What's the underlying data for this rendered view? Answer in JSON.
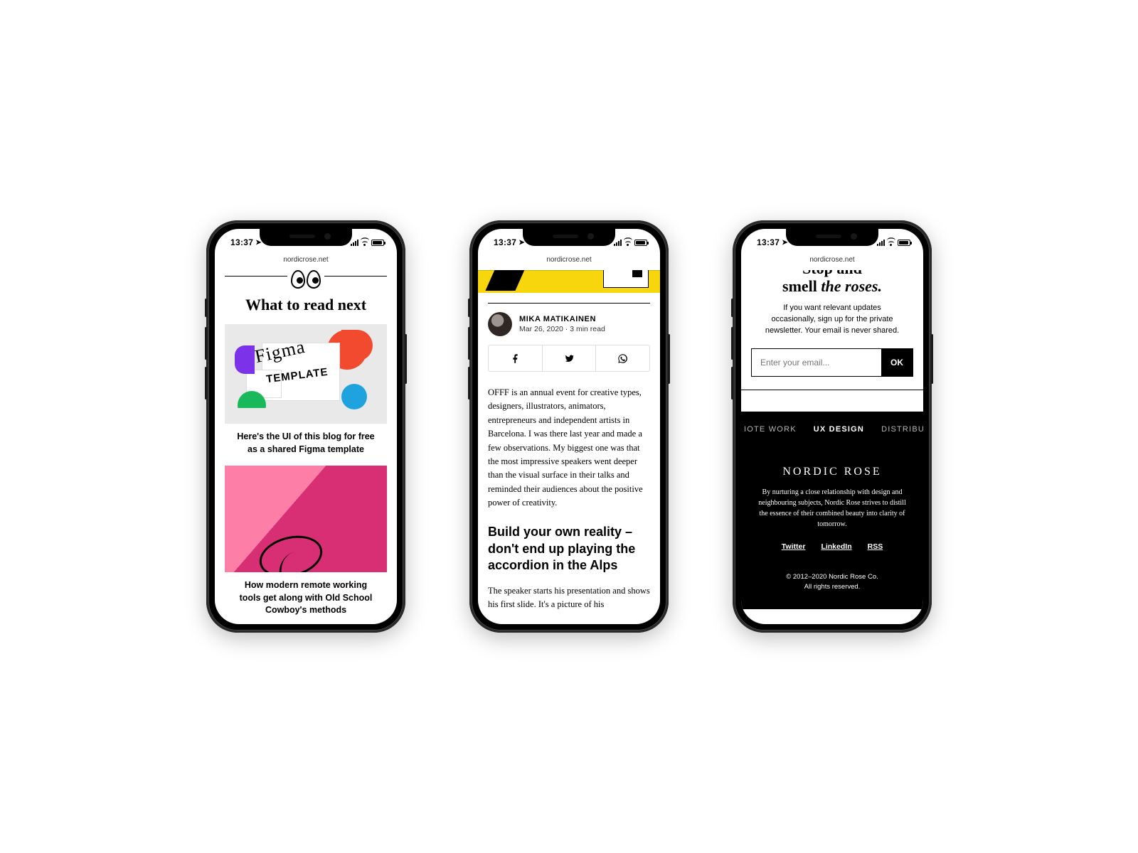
{
  "status": {
    "time": "13:37",
    "domain": "nordicrose.net"
  },
  "phone1": {
    "heading": "What to read next",
    "figma_word": "Figma",
    "template_word": "TEMPLATE",
    "card1_title": "Here's the UI of this blog for free as a shared Figma template",
    "card2_title": "How modern remote working tools get along with Old School Cowboy's methods"
  },
  "phone2": {
    "author_name": "MIKA MATIKAINEN",
    "author_meta": "Mar 26, 2020 · 3 min read",
    "paragraph1": "OFFF is an annual event for creative types, designers, illustrators, animators, entrepreneurs and independent artists in Barcelona. I was there last year and made a few observations. My biggest one was that the most impressive speakers went deeper than the visual surface in their talks and reminded their audiences about the positive power of creativity.",
    "article_heading": "Build your own reality – don't end up playing the accordion in the Alps",
    "paragraph2": "The speaker starts his presentation and shows his first slide. It's a picture of his"
  },
  "phone3": {
    "roses_line1_cut": "Stop and",
    "roses_smell": "smell",
    "roses_the_roses": " the roses.",
    "newsletter_desc": "If you want relevant updates occasionally, sign up for the private newsletter. Your email is never shared.",
    "email_placeholder": "Enter your email...",
    "ok_label": "OK",
    "tags": {
      "left": "IOTE WORK",
      "center": "UX DESIGN",
      "right": "DISTRIBUTED T"
    },
    "brand": "NORDIC ROSE",
    "footer_desc": "By nurturing a close relationship with design and neighbouring subjects, Nordic Rose strives to distill the essence of their combined beauty into clarity of tomorrow.",
    "links": {
      "twitter": "Twitter",
      "linkedin": "LinkedIn",
      "rss": "RSS"
    },
    "copyright1": "© 2012–2020 Nordic Rose Co.",
    "copyright2": "All rights reserved."
  }
}
